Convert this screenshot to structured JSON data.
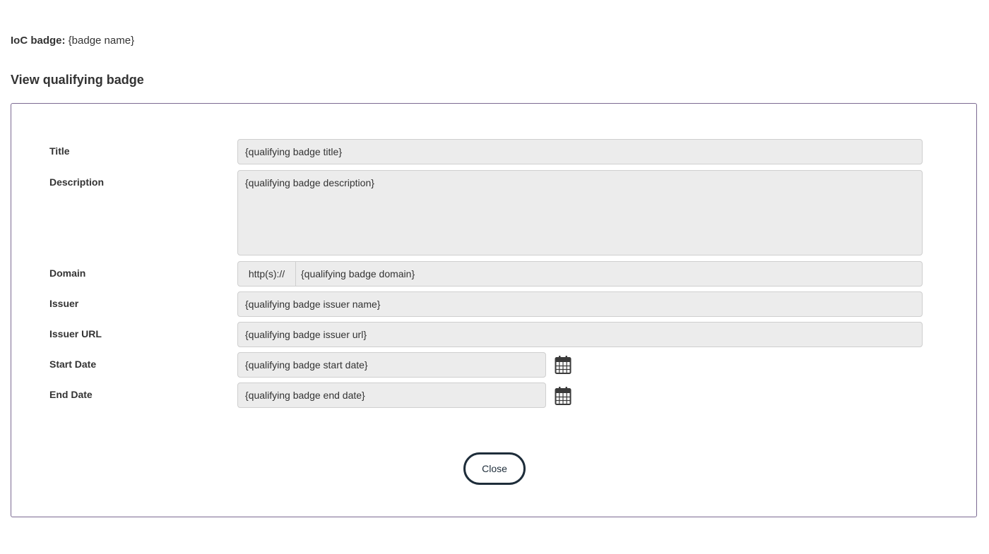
{
  "header": {
    "badge_label": "IoC badge:",
    "badge_value": "{badge name}",
    "section_title": "View qualifying badge"
  },
  "form": {
    "title": {
      "label": "Title",
      "value": "{qualifying badge title}"
    },
    "description": {
      "label": "Description",
      "value": "{qualifying badge description}"
    },
    "domain": {
      "label": "Domain",
      "prefix": "http(s)://",
      "value": "{qualifying badge domain}"
    },
    "issuer": {
      "label": "Issuer",
      "value": "{qualifying badge issuer name}"
    },
    "issuer_url": {
      "label": "Issuer URL",
      "value": "{qualifying badge issuer url}"
    },
    "start_date": {
      "label": "Start Date",
      "value": "{qualifying badge start date}"
    },
    "end_date": {
      "label": "End Date",
      "value": "{qualifying badge end date}"
    }
  },
  "actions": {
    "close_label": "Close"
  },
  "icons": {
    "calendar": "calendar-icon"
  },
  "colors": {
    "panel_border": "#7b6a92",
    "field_background": "#ececec",
    "button_border": "#1e2d3a"
  }
}
